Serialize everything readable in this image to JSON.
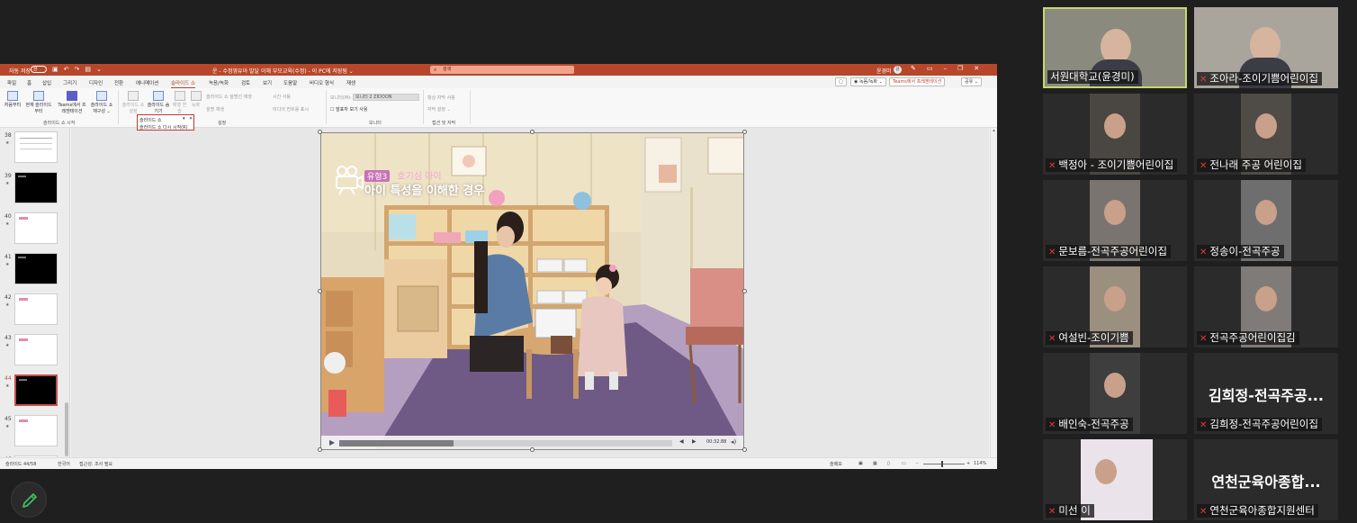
{
  "ppt": {
    "titlebar": {
      "autosave_label": "자동 저장",
      "autosave_state": "끔",
      "doc_title": "운 - 수정영유아 발달 이해 부모교육(수정) - 이 PC에 저장됨 ⌄",
      "search_placeholder": "검색",
      "user_name": "윤경미",
      "avatar_initial": "윤"
    },
    "tabs": [
      "파일",
      "홈",
      "삽입",
      "그리기",
      "디자인",
      "전환",
      "애니메이션",
      "슬라이드 쇼",
      "녹음/녹화",
      "검토",
      "보기",
      "도움말",
      "비디오 형식",
      "재생"
    ],
    "active_tab": "슬라이드 쇼",
    "right_buttons": {
      "record": "◉ 녹음/녹화 ⌄",
      "teams": "Teams에서 프레젠테이션",
      "share": "공유 ⌄"
    },
    "ribbon": {
      "buttons": [
        {
          "label": "처음부터"
        },
        {
          "label": "현재 슬라이드부터"
        },
        {
          "label": "Teams에서 프레젠테이션"
        },
        {
          "label": "슬라이드 쇼 재구성 ⌄"
        },
        {
          "label": "슬라이드 쇼 설정"
        },
        {
          "label": "슬라이드 숨기기"
        },
        {
          "label": "예행 연습"
        },
        {
          "label": "녹화"
        }
      ],
      "checks": [
        "슬라이드 쇼 설명선 재생",
        "시간 사용",
        "설명 재생",
        "미디어 컨트롤 표시"
      ],
      "monitor_label": "모니터(M):",
      "monitor_value": "모니터 2 ZIDOON",
      "presenter_view": "발표자 보기 사용",
      "subtitle_items": [
        "항상 자막 사용",
        "자막 설정 ⌄"
      ],
      "groups": [
        "슬라이드 쇼 시작",
        "설정",
        "모니터",
        "캡션 및 자막"
      ],
      "dropdown_top": "슬라이드 쇼",
      "dropdown_bottom": "슬라이드 쇼 다시 시작(R)"
    },
    "thumbnails": [
      {
        "num": "38",
        "star": "★"
      },
      {
        "num": "39",
        "star": "★"
      },
      {
        "num": "40",
        "star": "★"
      },
      {
        "num": "41",
        "star": "★"
      },
      {
        "num": "42",
        "star": "★"
      },
      {
        "num": "43",
        "star": "★"
      },
      {
        "num": "44",
        "star": "★"
      },
      {
        "num": "45",
        "star": "★"
      },
      {
        "num": "46",
        "star": ""
      }
    ],
    "selected_slide": "44",
    "slide": {
      "badge": "유형3",
      "subtitle_pink": "호기심 아이",
      "title": "아이 특성을 이해한 경우",
      "video_time": "00:32.88"
    },
    "statusbar": {
      "slide_count": "슬라이드 44/58",
      "language": "한국어",
      "accessibility": "접근성: 조사 필요",
      "notes": "슬메모",
      "zoom": "114%"
    }
  },
  "gallery": {
    "tiles": [
      {
        "name": "서원대학교(윤경미)",
        "muted": false,
        "video": true
      },
      {
        "name": "조아라-조이기쁨어린이집",
        "muted": true,
        "video": true
      },
      {
        "name": "백정아 - 조이기쁨어린이집",
        "muted": true,
        "video": true
      },
      {
        "name": "전나래 주공 어린이집",
        "muted": true,
        "video": true
      },
      {
        "name": "문보름-전곡주공어린이집",
        "muted": true,
        "video": true
      },
      {
        "name": "정송이-전곡주공",
        "muted": true,
        "video": true
      },
      {
        "name": "여설빈-조이기쁨",
        "muted": true,
        "video": true
      },
      {
        "name": "전곡주공어린이집김",
        "muted": true,
        "video": true
      },
      {
        "name": "배인숙-전곡주공",
        "muted": true,
        "video": true
      },
      {
        "name": "김희정-전곡주공어린이집",
        "muted": true,
        "video": false,
        "display": "김희정-전곡주공..."
      },
      {
        "name": "미선 이",
        "muted": true,
        "video": true
      },
      {
        "name": "연천군육아종합지원센터",
        "muted": true,
        "video": false,
        "display": "연천군육아종합..."
      }
    ]
  },
  "colors": {
    "ppt_accent": "#b7472a",
    "active_speaker": "#c7d96b",
    "muted_mic": "#e53935"
  }
}
